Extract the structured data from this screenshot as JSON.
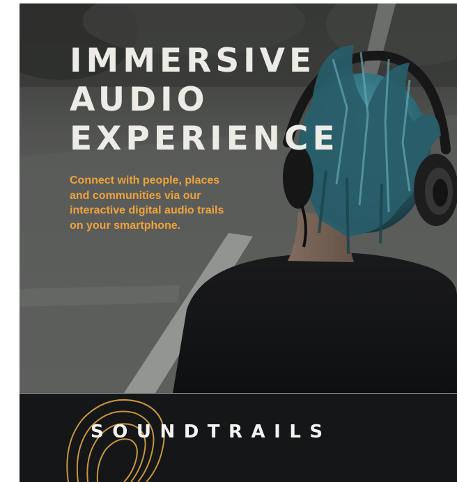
{
  "hero": {
    "headline_lines": [
      "IMMERSIVE",
      "AUDIO",
      "EXPERIENCE"
    ],
    "tagline_lines": [
      "Connect with people, places",
      "and communities via our",
      "interactive digital audio trails",
      "on your smartphone."
    ]
  },
  "footer": {
    "brand": "SOUNDTRAILS"
  },
  "colors": {
    "headline": "#ecebe6",
    "tagline": "#f0a33c",
    "footer_bg": "#141617",
    "logo_stroke": "#c9963f"
  },
  "icons": [
    "soundtrails-logo-mark-icon",
    "person-with-headphones-photo"
  ]
}
